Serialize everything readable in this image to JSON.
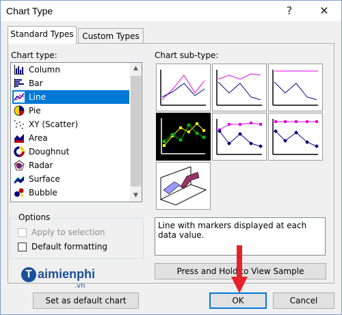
{
  "window": {
    "title": "Chart Type",
    "help_glyph": "?",
    "close_glyph": "✕"
  },
  "tabs": [
    {
      "label": "Standard Types",
      "active": true
    },
    {
      "label": "Custom Types",
      "active": false
    }
  ],
  "chart_type_label": "Chart type:",
  "chart_types": [
    {
      "label": "Column",
      "icon": "column-chart-icon"
    },
    {
      "label": "Bar",
      "icon": "bar-chart-icon"
    },
    {
      "label": "Line",
      "icon": "line-chart-icon",
      "selected": true
    },
    {
      "label": "Pie",
      "icon": "pie-chart-icon"
    },
    {
      "label": "XY (Scatter)",
      "icon": "scatter-chart-icon"
    },
    {
      "label": "Area",
      "icon": "area-chart-icon"
    },
    {
      "label": "Doughnut",
      "icon": "doughnut-chart-icon"
    },
    {
      "label": "Radar",
      "icon": "radar-chart-icon"
    },
    {
      "label": "Surface",
      "icon": "surface-chart-icon"
    },
    {
      "label": "Bubble",
      "icon": "bubble-chart-icon"
    }
  ],
  "subtype_label": "Chart sub-type:",
  "options": {
    "label": "Options",
    "apply_to_selection": "Apply to selection",
    "default_formatting": "Default formatting"
  },
  "description": "Line with markers displayed at each data value.",
  "buttons": {
    "press_hold": "Press and Hold to View Sample",
    "set_default": "Set as default chart",
    "ok": "OK",
    "cancel": "Cancel"
  },
  "watermark": {
    "brand": "aimienphi",
    "brand_initial": "T",
    "domain": ".vn"
  },
  "colors": {
    "selection": "#0078d7",
    "arrow": "#e8202a",
    "brand": "#1a4f9c"
  }
}
